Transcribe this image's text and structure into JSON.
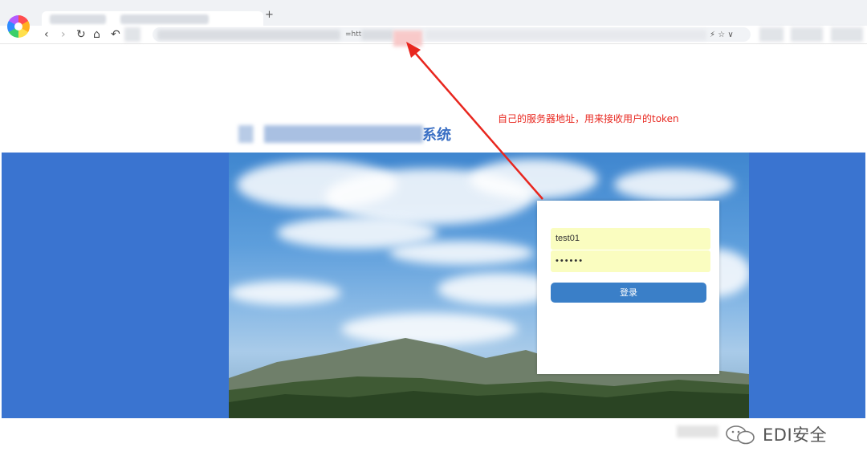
{
  "browser": {
    "new_tab_glyph": "+",
    "nav_icons": {
      "back": "‹",
      "forward": "›",
      "reload": "↻",
      "home": "⌂",
      "undo": "↶"
    },
    "address_prefix": "=htt",
    "address_icons": "⚡ ☆ ∨"
  },
  "annotation": {
    "text": "自己的服务器地址，用来接收用户的token",
    "color": "#e8261e"
  },
  "page": {
    "title_visible_tail": "系统",
    "band_color": "#3a74d0"
  },
  "login": {
    "username_value": "test01",
    "password_value": "••••••",
    "submit_label": "登录",
    "input_bg": "#fafdc0",
    "button_color": "#3a7fc8"
  },
  "watermark": {
    "text": "EDI安全"
  }
}
